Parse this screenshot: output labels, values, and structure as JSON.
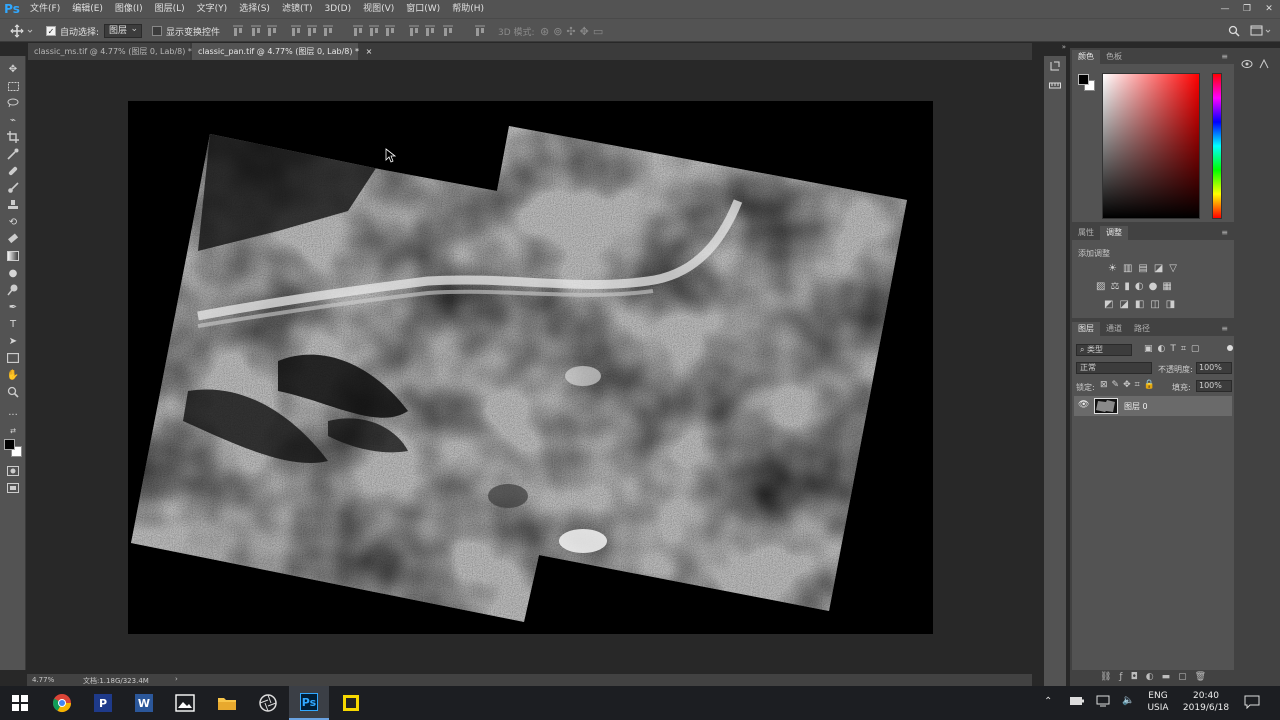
{
  "app": {
    "logo_text": "Ps"
  },
  "menubar": {
    "items": [
      "文件(F)",
      "编辑(E)",
      "图像(I)",
      "图层(L)",
      "文字(Y)",
      "选择(S)",
      "滤镜(T)",
      "3D(D)",
      "视图(V)",
      "窗口(W)",
      "帮助(H)"
    ]
  },
  "options": {
    "auto_select_label": "自动选择:",
    "auto_select_checked": true,
    "auto_select_target": "图层",
    "show_transform_label": "显示变换控件",
    "show_transform_checked": false,
    "mode_3d_label": "3D 模式:"
  },
  "tabs": [
    {
      "label": "classic_ms.tif @ 4.77% (图层 0, Lab/8) *",
      "active": false
    },
    {
      "label": "classic_pan.tif @ 4.77% (图层 0, Lab/8) *",
      "active": true
    }
  ],
  "status": {
    "zoom": "4.77%",
    "doc_info": "文档:1.18G/323.4M"
  },
  "color_panel": {
    "tabs": [
      "颜色",
      "色板"
    ],
    "foreground": "#000000",
    "background": "#ffffff",
    "hue_color": "#ff0000"
  },
  "adjust_panel": {
    "tabs": [
      "属性",
      "调整"
    ],
    "add_adjustment_label": "添加调整"
  },
  "layers_panel": {
    "tabs": [
      "图层",
      "通道",
      "路径"
    ],
    "filter_label": "类型",
    "blend_mode": "正常",
    "opacity_label": "不透明度:",
    "opacity_value": "100%",
    "lock_label": "锁定:",
    "fill_label": "填充:",
    "fill_value": "100%",
    "layers": [
      {
        "name": "图层 0",
        "visible": true
      }
    ]
  },
  "taskbar": {
    "tray_lang": "ENG",
    "tray_region": "USIA",
    "time": "20:40",
    "date": "2019/6/18"
  }
}
